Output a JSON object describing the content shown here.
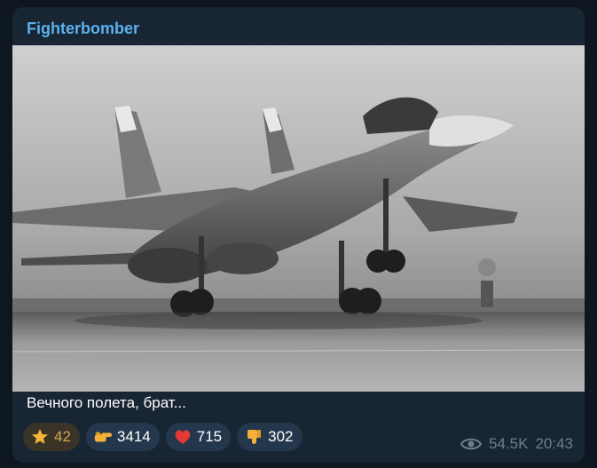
{
  "post": {
    "channel_name": "Fighterbomber",
    "caption": "Вечного полета, брат...",
    "image": {
      "subject": "aircraft-photo"
    },
    "reactions": [
      {
        "icon": "star-icon",
        "count": "42"
      },
      {
        "icon": "pointing-hand-icon",
        "count": "3414"
      },
      {
        "icon": "heart-icon",
        "count": "715"
      },
      {
        "icon": "thumbs-down-icon",
        "count": "302"
      }
    ],
    "views": "54.5K",
    "time": "20:43"
  },
  "colors": {
    "background": "#0e1621",
    "bubble": "#182533",
    "channel_name": "#5cb0ed",
    "reaction_bg": "#24374c",
    "star_reaction_bg": "#3a3327",
    "meta_text": "#6d7f8f"
  }
}
